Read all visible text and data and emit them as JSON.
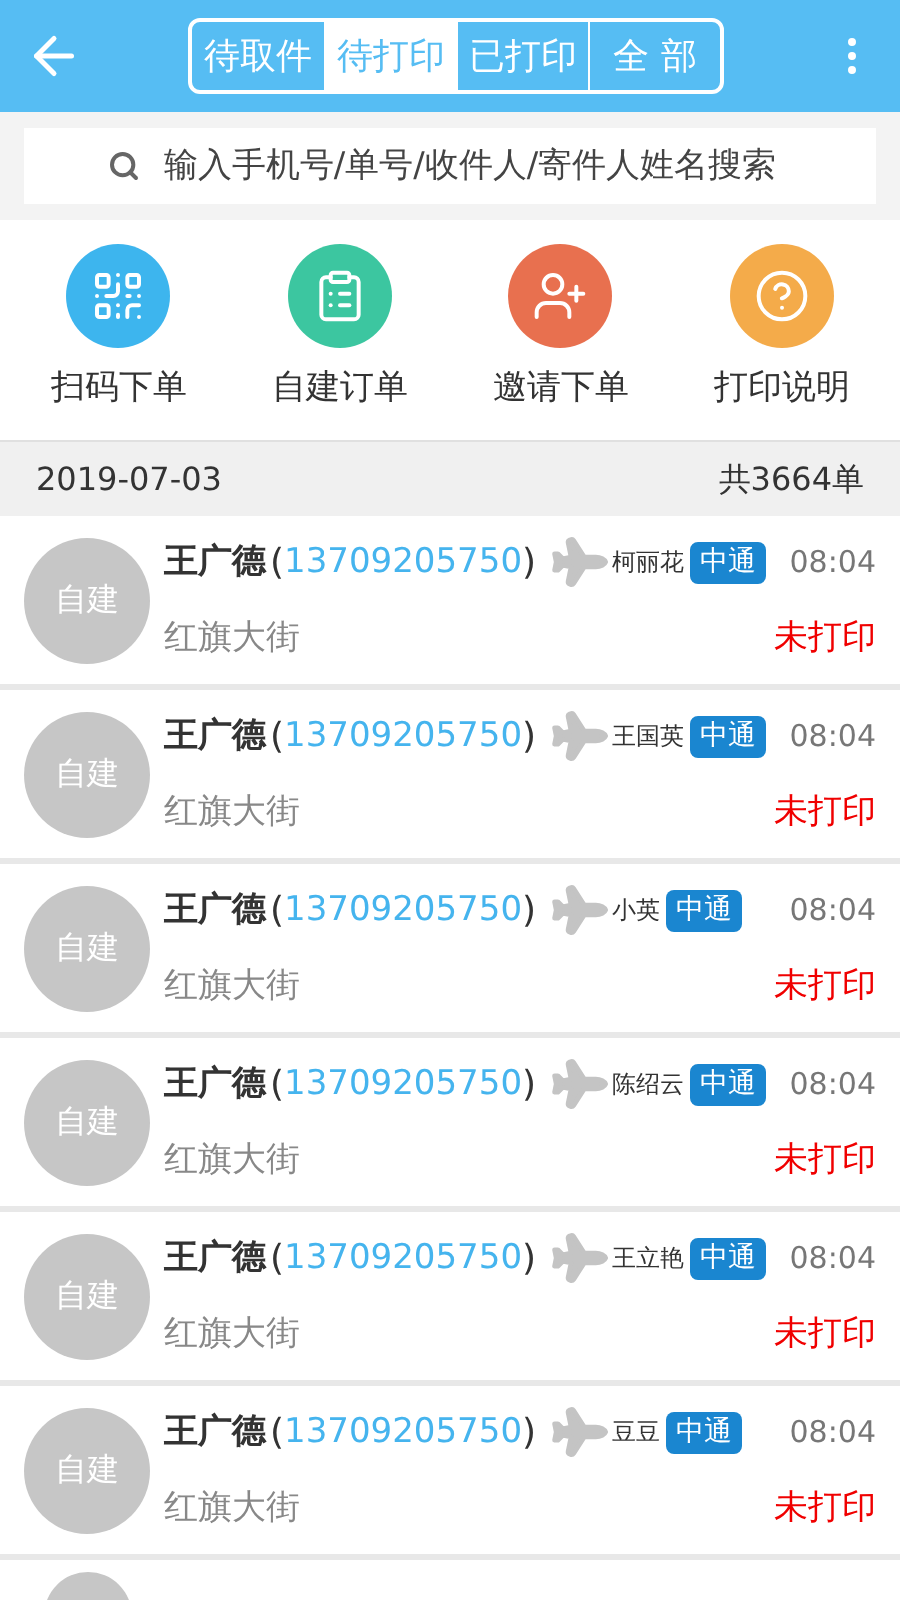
{
  "tabs": [
    {
      "label": "待取件",
      "selected": false
    },
    {
      "label": "待打印",
      "selected": true
    },
    {
      "label": "已打印",
      "selected": false
    },
    {
      "label": "全 部",
      "selected": false
    }
  ],
  "search": {
    "placeholder": "输入手机号/单号/收件人/寄件人姓名搜索"
  },
  "phone_brackets": {
    "open": "(",
    "close": ")"
  },
  "actions": [
    {
      "kind": "scan",
      "label": "扫码下单",
      "color": "#3db5ee"
    },
    {
      "kind": "create",
      "label": "自建订单",
      "color": "#3cc6a0"
    },
    {
      "kind": "invite",
      "label": "邀请下单",
      "color": "#e8704f"
    },
    {
      "kind": "help",
      "label": "打印说明",
      "color": "#f4ab4a"
    }
  ],
  "date_bar": {
    "date": "2019-07-03",
    "total": "共3664单"
  },
  "orders": [
    {
      "avatar": "自建",
      "sender": "王广德",
      "phone": "13709205750",
      "recipient": "柯丽花",
      "carrier": "中通",
      "time": "08:04",
      "address": "红旗大街",
      "status": "未打印"
    },
    {
      "avatar": "自建",
      "sender": "王广德",
      "phone": "13709205750",
      "recipient": "王国英",
      "carrier": "中通",
      "time": "08:04",
      "address": "红旗大街",
      "status": "未打印"
    },
    {
      "avatar": "自建",
      "sender": "王广德",
      "phone": "13709205750",
      "recipient": "小英",
      "carrier": "中通",
      "time": "08:04",
      "address": "红旗大街",
      "status": "未打印"
    },
    {
      "avatar": "自建",
      "sender": "王广德",
      "phone": "13709205750",
      "recipient": "陈绍云",
      "carrier": "中通",
      "time": "08:04",
      "address": "红旗大街",
      "status": "未打印"
    },
    {
      "avatar": "自建",
      "sender": "王广德",
      "phone": "13709205750",
      "recipient": "王立艳",
      "carrier": "中通",
      "time": "08:04",
      "address": "红旗大街",
      "status": "未打印"
    },
    {
      "avatar": "自建",
      "sender": "王广德",
      "phone": "13709205750",
      "recipient": "豆豆",
      "carrier": "中通",
      "time": "08:04",
      "address": "红旗大街",
      "status": "未打印"
    }
  ]
}
